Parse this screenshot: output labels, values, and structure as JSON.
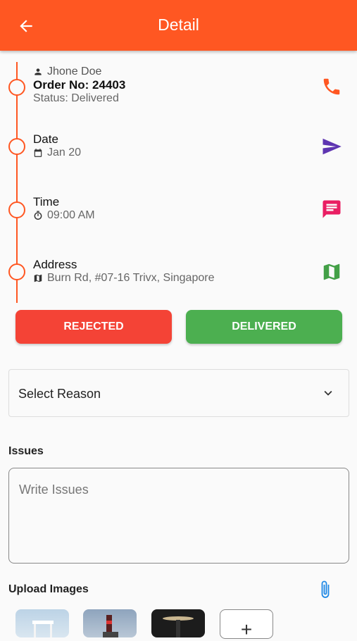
{
  "appbar": {
    "title": "Detail",
    "back_icon": "arrow-back-icon"
  },
  "timeline": {
    "color": "#ff5722",
    "order": {
      "customer": "Jhone Doe",
      "order_no": "Order No: 24403",
      "status": "Status: Delivered",
      "action_icon": "phone-icon",
      "action_color": "#ff5722"
    },
    "date": {
      "title": "Date",
      "value": "Jan 20",
      "action_icon": "send-icon",
      "action_color": "#5e35b1"
    },
    "time": {
      "title": "Time",
      "value": "09:00 AM",
      "action_icon": "message-icon",
      "action_color": "#e91e63"
    },
    "address": {
      "title": "Address",
      "value": "Burn Rd, #07-16 Trivx, Singapore",
      "action_icon": "map-icon",
      "action_color": "#43a047"
    }
  },
  "buttons": {
    "rejected": "REJECTED",
    "delivered": "DELIVERED"
  },
  "reason_select": {
    "placeholder": "Select Reason"
  },
  "issues": {
    "label": "Issues",
    "placeholder": "Write Issues"
  },
  "upload": {
    "label": "Upload Images",
    "add_label": "+"
  },
  "colors": {
    "primary": "#ff5722",
    "reject": "#f44336",
    "deliver": "#4caf50",
    "attach": "#1e88e5"
  }
}
